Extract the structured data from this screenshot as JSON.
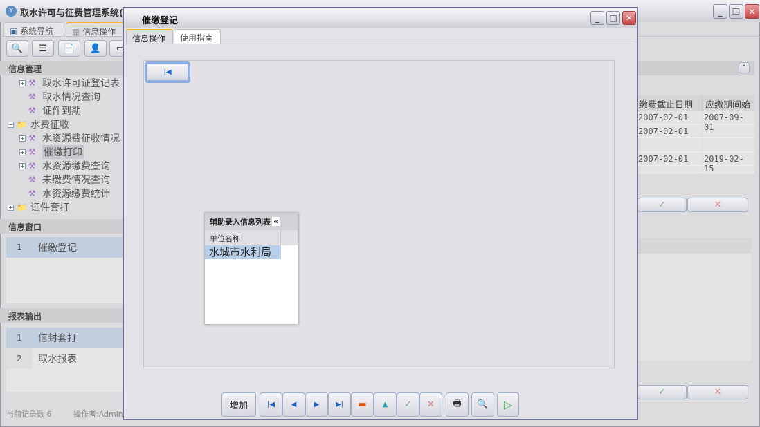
{
  "main": {
    "title": "取水许可与征费管理系统(非",
    "tabs": [
      {
        "label": "系统导航"
      },
      {
        "label": "信息操作"
      }
    ],
    "toolbar_icons": [
      "search-icon",
      "list-icon",
      "document-icon",
      "user-icon",
      "monitor-icon"
    ],
    "sections": {
      "info_manage": "信息管理",
      "info_window": "信息窗口",
      "report_output": "报表输出"
    },
    "tree": [
      {
        "label": "取水许可证登记表",
        "level": 1,
        "expander": "+"
      },
      {
        "label": "取水情况查询",
        "level": 1,
        "expander": ""
      },
      {
        "label": "证件到期",
        "level": 1,
        "expander": ""
      },
      {
        "label": "水费征收",
        "level": 0,
        "expander": "-",
        "folder": true
      },
      {
        "label": "水资源费征收情况",
        "level": 1,
        "expander": "+"
      },
      {
        "label": "催缴打印",
        "level": 1,
        "expander": "+",
        "selected": true
      },
      {
        "label": "水资源缴费查询",
        "level": 1,
        "expander": "+"
      },
      {
        "label": "未缴费情况查询",
        "level": 1,
        "expander": ""
      },
      {
        "label": "水资源缴费统计",
        "level": 1,
        "expander": ""
      },
      {
        "label": "证件套打",
        "level": 0,
        "expander": "+",
        "folder": true
      }
    ],
    "info_window_rows": [
      {
        "n": "1",
        "label": "催缴登记"
      }
    ],
    "report_rows": [
      {
        "n": "1",
        "label": "信封套打"
      },
      {
        "n": "2",
        "label": "取水报表"
      }
    ],
    "status": {
      "records": "当前记录数 6",
      "operator": "操作者:Admin"
    },
    "table": {
      "headers": [
        "缴费截止日期",
        "应缴期间始"
      ],
      "rows": [
        [
          "2007-02-01",
          "2007-09-01"
        ],
        [
          "2007-02-01",
          ""
        ],
        [
          "",
          ""
        ],
        [
          "2007-02-01",
          "2019-02-15"
        ],
        [
          "",
          ""
        ]
      ]
    }
  },
  "dialog": {
    "title": "催缴登记",
    "tabs": [
      {
        "label": "信息操作"
      },
      {
        "label": "使用指南"
      }
    ],
    "aux_panel": {
      "title": "辅助录入信息列表",
      "collapse": "«",
      "column": "单位名称",
      "rows": [
        "水城市水利局"
      ]
    },
    "buttons": {
      "add": "增加"
    }
  }
}
